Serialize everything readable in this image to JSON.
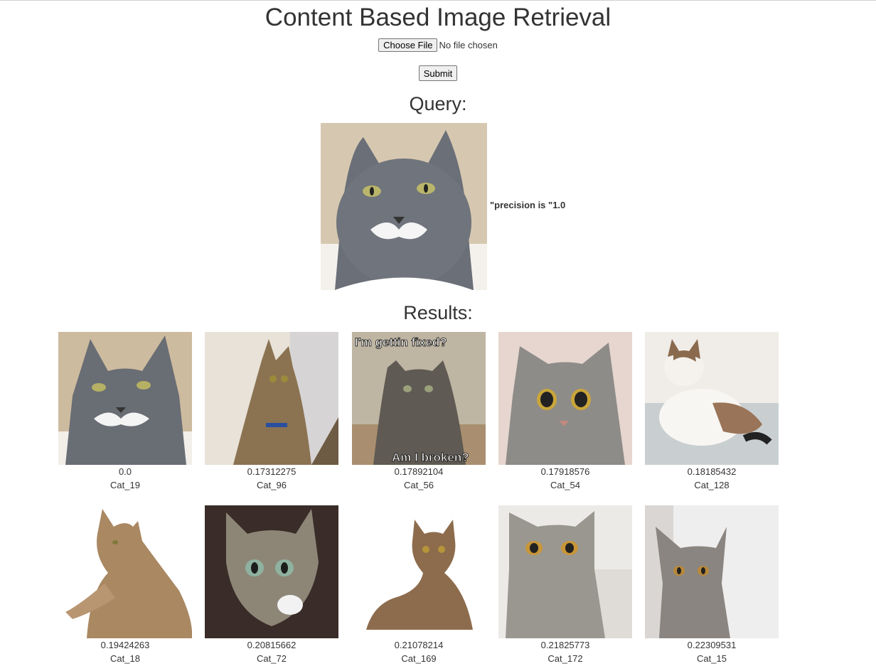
{
  "page": {
    "title": "Content Based Image Retrieval"
  },
  "upload": {
    "choose_file_label": "Choose File",
    "file_status": "No file chosen",
    "submit_label": "Submit"
  },
  "query": {
    "heading": "Query:",
    "precision_text": "\"precision is \"1.0"
  },
  "results": {
    "heading": "Results:",
    "items": [
      {
        "score": "0.0",
        "label": "Cat_19",
        "caption_top": "",
        "caption_bottom": ""
      },
      {
        "score": "0.17312275",
        "label": "Cat_96",
        "caption_top": "",
        "caption_bottom": ""
      },
      {
        "score": "0.17892104",
        "label": "Cat_56",
        "caption_top": "I'm gettin fixed?",
        "caption_bottom": "Am I broken?"
      },
      {
        "score": "0.17918576",
        "label": "Cat_54",
        "caption_top": "",
        "caption_bottom": ""
      },
      {
        "score": "0.18185432",
        "label": "Cat_128",
        "caption_top": "",
        "caption_bottom": ""
      },
      {
        "score": "0.19424263",
        "label": "Cat_18",
        "caption_top": "",
        "caption_bottom": ""
      },
      {
        "score": "0.20815662",
        "label": "Cat_72",
        "caption_top": "",
        "caption_bottom": ""
      },
      {
        "score": "0.21078214",
        "label": "Cat_169",
        "caption_top": "",
        "caption_bottom": ""
      },
      {
        "score": "0.21825773",
        "label": "Cat_172",
        "caption_top": "",
        "caption_bottom": ""
      },
      {
        "score": "0.22309531",
        "label": "Cat_15",
        "caption_top": "",
        "caption_bottom": ""
      }
    ]
  }
}
